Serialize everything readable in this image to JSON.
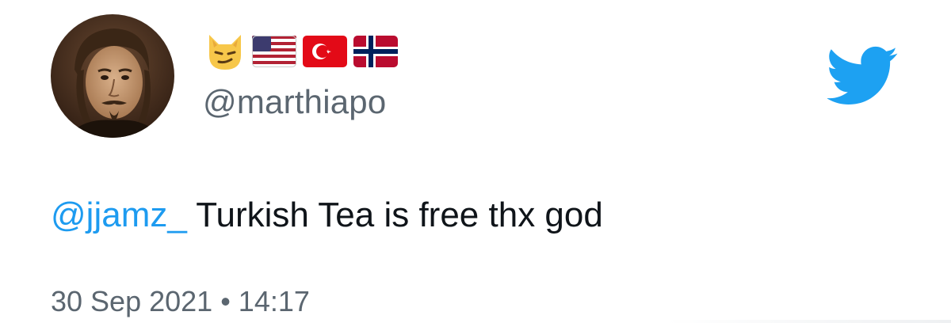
{
  "user": {
    "handle": "@marthiapo",
    "avatar_alt": "profile-portrait",
    "display_emojis": [
      "smirking-cat-emoji",
      "us-flag-emoji",
      "turkey-flag-emoji",
      "norway-flag-emoji"
    ]
  },
  "tweet": {
    "mention": "@jjamz_",
    "body": " Turkish Tea is free thx god",
    "date": "30 Sep 2021",
    "separator": " • ",
    "time": "14:17"
  },
  "colors": {
    "link": "#1d9bf0",
    "twitter_brand": "#1da1f2",
    "secondary_text": "#5b6670",
    "primary_text": "#0f1419"
  },
  "icons": {
    "logo": "twitter-bird-icon"
  }
}
